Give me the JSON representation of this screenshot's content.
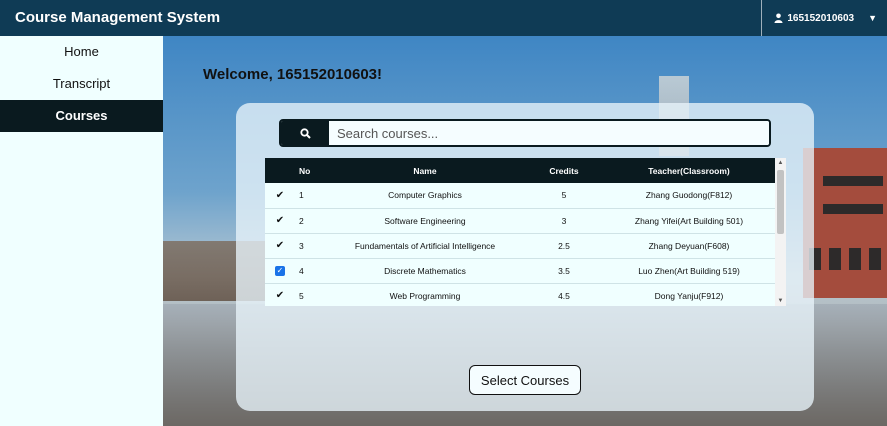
{
  "header": {
    "title": "Course Management System",
    "user_icon": "user-icon",
    "username": "165152010603",
    "caret_icon": "caret-down-icon",
    "background": "#0f3b55"
  },
  "sidebar": {
    "items": [
      {
        "label": "Home",
        "active": false
      },
      {
        "label": "Transcript",
        "active": false
      },
      {
        "label": "Courses",
        "active": true
      }
    ]
  },
  "main": {
    "welcome": "Welcome, 165152010603!",
    "search": {
      "placeholder": "Search courses...",
      "value": "",
      "icon": "search-icon"
    },
    "table": {
      "columns": [
        "",
        "No",
        "Name",
        "Credits",
        "Teacher(Classroom)"
      ],
      "rows": [
        {
          "state": "check",
          "no": "1",
          "name": "Computer Graphics",
          "credits": "5",
          "teacher": "Zhang Guodong(F812)"
        },
        {
          "state": "check",
          "no": "2",
          "name": "Software Engineering",
          "credits": "3",
          "teacher": "Zhang Yifei(Art Building 501)"
        },
        {
          "state": "check",
          "no": "3",
          "name": "Fundamentals of Artificial Intelligence",
          "credits": "2.5",
          "teacher": "Zhang Deyuan(F608)"
        },
        {
          "state": "checkbox",
          "no": "4",
          "name": "Discrete Mathematics",
          "credits": "3.5",
          "teacher": "Luo Zhen(Art Building 519)"
        },
        {
          "state": "check",
          "no": "5",
          "name": "Web Programming",
          "credits": "4.5",
          "teacher": "Dong Yanju(F912)"
        }
      ]
    },
    "select_button": "Select Courses"
  },
  "colors": {
    "accent_dark": "#0a1a1f",
    "sidebar_bg": "#f0ffff",
    "checkbox": "#1a73e8"
  }
}
